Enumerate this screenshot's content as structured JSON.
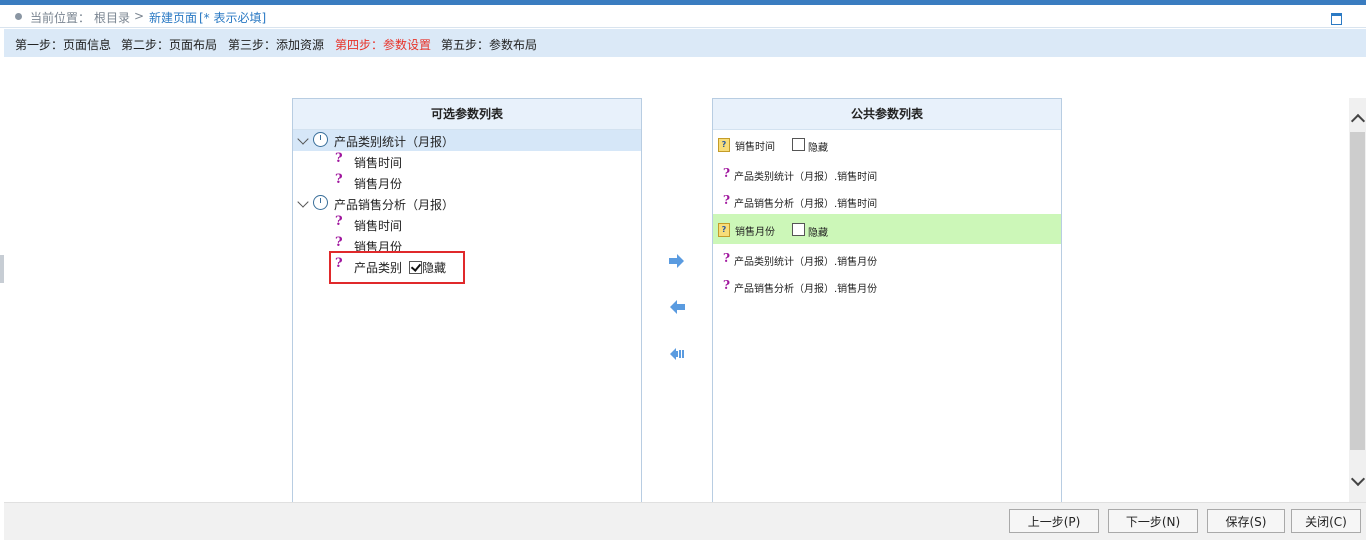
{
  "breadcrumb": {
    "location_label": "当前位置：",
    "root": "根目录",
    "separator": ">",
    "current": "新建页面",
    "required_hint": "[* 表示必填]"
  },
  "steps": [
    {
      "label": "第一步：页面信息",
      "active": false
    },
    {
      "label": "第二步：页面布局",
      "active": false
    },
    {
      "label": "第三步：添加资源",
      "active": false
    },
    {
      "label": "第四步：参数设置",
      "active": true
    },
    {
      "label": "第五步：参数布局",
      "active": false
    }
  ],
  "left_panel": {
    "title": "可选参数列表",
    "groups": [
      {
        "label": "产品类别统计（月报）",
        "items": [
          "销售时间",
          "销售月份"
        ]
      },
      {
        "label": "产品销售分析（月报）",
        "items": [
          "销售时间",
          "销售月份",
          "产品类别"
        ]
      }
    ],
    "hide_label": "隐藏",
    "hide_checked": true
  },
  "right_panel": {
    "title": "公共参数列表",
    "params": [
      {
        "label": "销售时间",
        "hide_label": "隐藏",
        "hide_checked": false,
        "refs": [
          "产品类别统计（月报）.销售时间",
          "产品销售分析（月报）.销售时间"
        ]
      },
      {
        "label": "销售月份",
        "hide_label": "隐藏",
        "hide_checked": false,
        "refs": [
          "产品类别统计（月报）.销售月份",
          "产品销售分析（月报）.销售月份"
        ]
      }
    ]
  },
  "footer": {
    "prev": "上一步(P)",
    "next": "下一步(N)",
    "save": "保存(S)",
    "close": "关闭(C)"
  },
  "colors": {
    "accent": "#3a7cc0",
    "active_step": "#e8332a",
    "highlight_row": "#ccf7b8",
    "question_mark": "#a0169e"
  },
  "icons": [
    "maximize-icon",
    "clock-icon",
    "question-icon",
    "param-icon",
    "arrow-right-icon",
    "arrow-left-icon",
    "arrow-left-all-icon"
  ]
}
